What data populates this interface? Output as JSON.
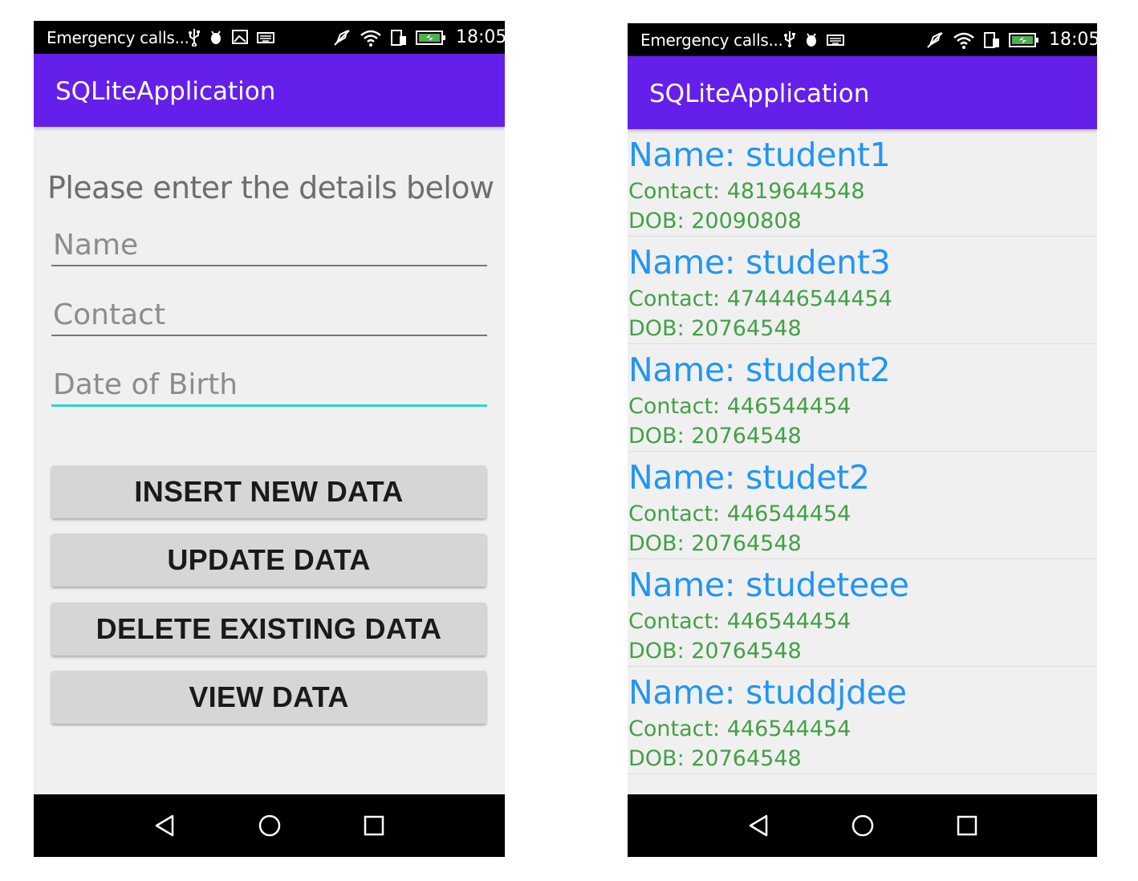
{
  "left_screen": {
    "status_bar": {
      "carrier_text": "Emergency calls...",
      "time": "18:05"
    },
    "app_title": "SQLiteApplication",
    "form": {
      "heading": "Please enter the details below",
      "name_placeholder": "Name",
      "contact_placeholder": "Contact",
      "dob_placeholder": "Date of Birth"
    },
    "buttons": {
      "insert": "INSERT NEW DATA",
      "update": "UPDATE DATA",
      "delete": "DELETE EXISTING DATA",
      "view": "VIEW DATA"
    }
  },
  "right_screen": {
    "status_bar": {
      "carrier_text": "Emergency calls...",
      "time": "18:05"
    },
    "app_title": "SQLiteApplication",
    "students": [
      {
        "name": "Name: student1",
        "contact": "Contact: 4819644548",
        "dob": "DOB: 20090808"
      },
      {
        "name": "Name: student3",
        "contact": "Contact: 474446544454",
        "dob": "DOB: 20764548"
      },
      {
        "name": "Name: student2",
        "contact": "Contact: 446544454",
        "dob": "DOB: 20764548"
      },
      {
        "name": "Name: studet2",
        "contact": "Contact: 446544454",
        "dob": "DOB: 20764548"
      },
      {
        "name": "Name: studeteee",
        "contact": "Contact: 446544454",
        "dob": "DOB: 20764548"
      },
      {
        "name": "Name: studdjdee",
        "contact": "Contact: 446544454",
        "dob": "DOB: 20764548"
      }
    ]
  },
  "colors": {
    "app_bar": "#6420ea",
    "name_text": "#2196f3",
    "detail_text": "#43a047",
    "focused_underline": "#2ed6c4"
  },
  "icons": {
    "status_left": [
      "usb-icon",
      "android-debug-icon",
      "image-icon",
      "keyboard-icon"
    ],
    "status_right": [
      "silent-icon",
      "wifi-icon",
      "phone-data-icon",
      "battery-charging-icon"
    ],
    "nav": [
      "back-icon",
      "home-icon",
      "recents-icon"
    ]
  }
}
